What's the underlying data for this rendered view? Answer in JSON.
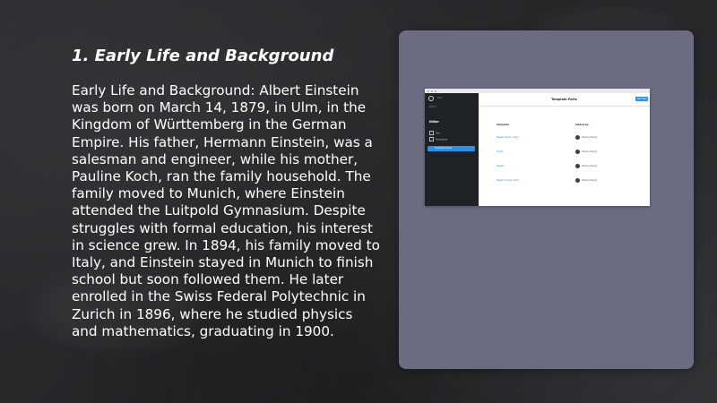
{
  "slide": {
    "title": "1. Early Life and Background",
    "body": "Early Life and Background: Albert Einstein was born on March 14, 1879, in Ulm, in the Kingdom of Württemberg in the German Empire. His father, Hermann Einstein, was a salesman and engineer, while his mother, Pauline Koch, ran the family household. The family moved to Munich, where Einstein attended the Luitpold Gymnasium. Despite struggles with formal education, his interest in science grew. In 1894, his family moved to Italy, and Einstein stayed in Munich to finish school but soon followed them. He later enrolled in the Swiss Federal Polytechnic in Zurich in 1896, where he studied physics and mathematics, graduating in 1900."
  },
  "embedded_app": {
    "header_title": "Template Parts",
    "top_button": "Add New",
    "sidebar": {
      "small_text": "Site",
      "sub_text": "Editor",
      "heading": "Editor",
      "items": [
        {
          "label": "Site"
        },
        {
          "label": "Templates"
        },
        {
          "label": "Template Parts"
        }
      ]
    },
    "columns": [
      "Template",
      "Added by"
    ],
    "rows": [
      {
        "template": "Header (Dark, large)",
        "added_by": "Twenty Twenty"
      },
      {
        "template": "Footer",
        "added_by": "Twenty Twenty"
      },
      {
        "template": "Header",
        "added_by": "Twenty Twenty"
      },
      {
        "template": "Header (Large, dark)",
        "added_by": "Twenty Twenty"
      }
    ]
  },
  "colors": {
    "card_bg": "#6b6b82",
    "accent": "#2f8fe0",
    "sidebar_bg": "#1f2226"
  }
}
